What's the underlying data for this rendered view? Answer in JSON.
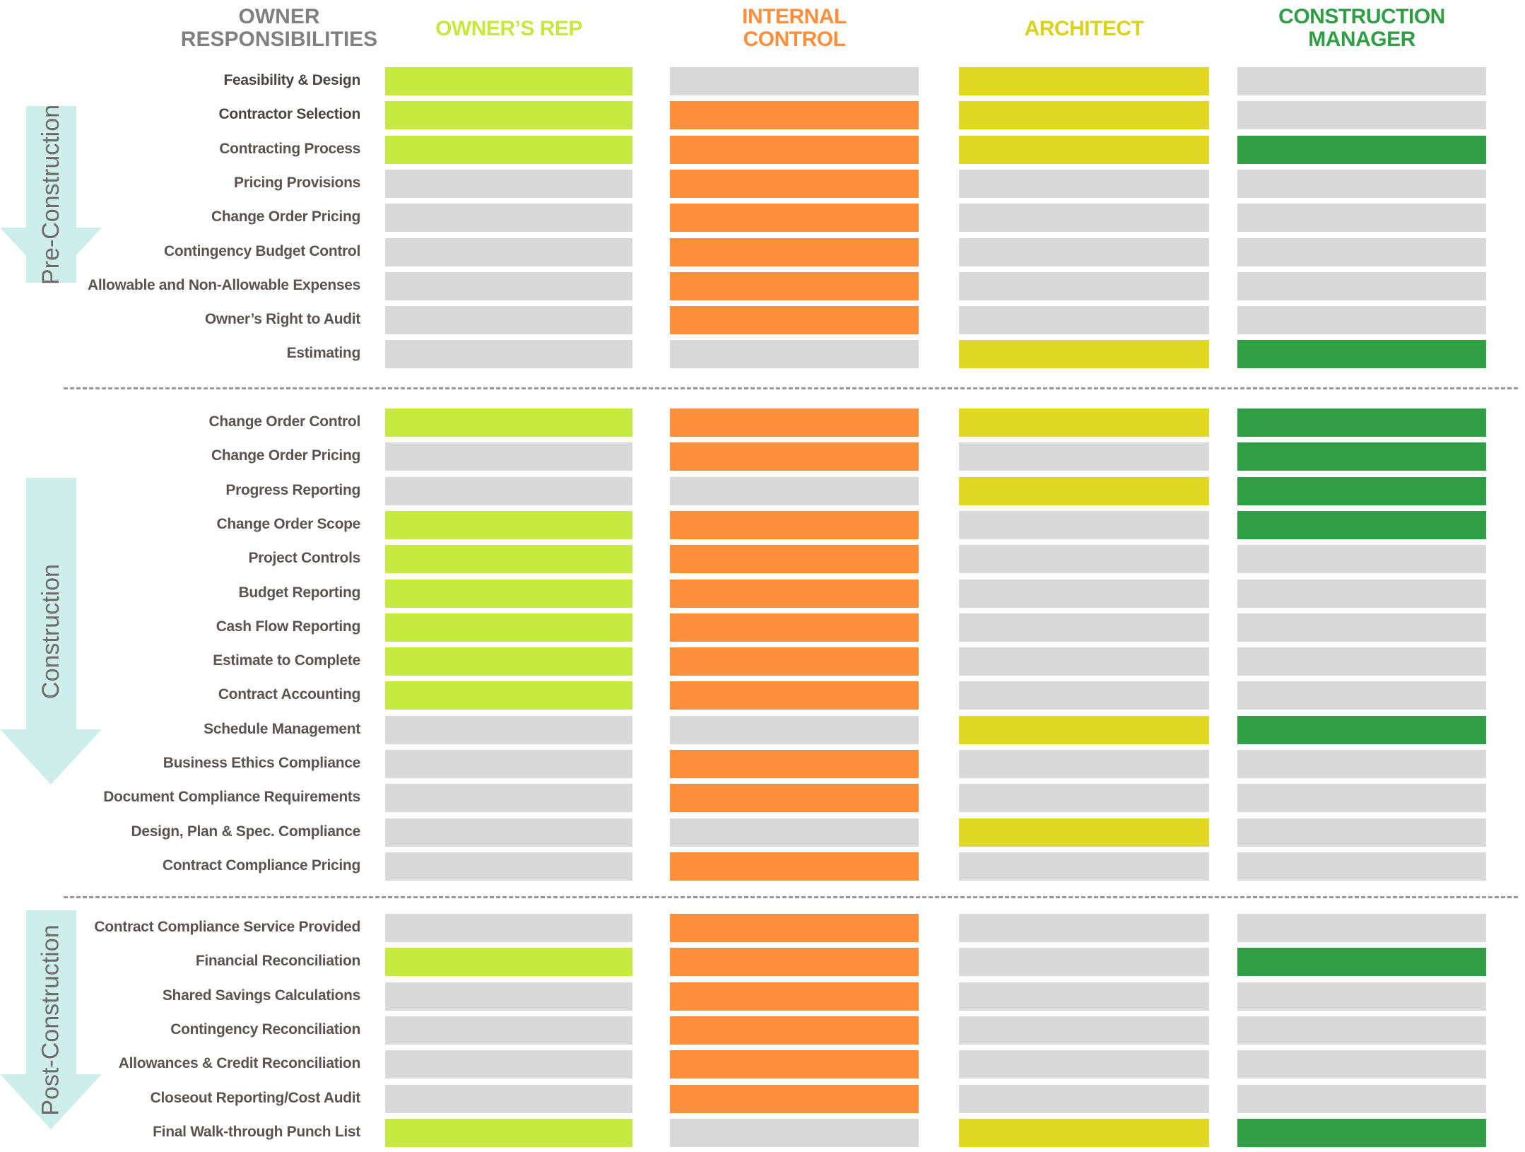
{
  "columns": [
    {
      "key": "owner_resp",
      "label": "OWNER\nRESPONSIBILITIES",
      "color": "#808080"
    },
    {
      "key": "owners_rep",
      "label": "OWNER’S REP",
      "color": "#c6e83f"
    },
    {
      "key": "internal_control",
      "label": "INTERNAL\nCONTROL",
      "color": "#fb8f3b"
    },
    {
      "key": "architect",
      "label": "ARCHITECT",
      "color": "#d9d21f"
    },
    {
      "key": "construction_manager",
      "label": "CONSTRUCTION\nMANAGER",
      "color": "#2f9e45"
    }
  ],
  "legend_colors": {
    "owners_rep": "#c6e83f",
    "internal_control": "#fb8f3b",
    "architect": "#dfd923",
    "construction_manager": "#2f9e45",
    "inactive": "#d9d9d9",
    "arrow": "#cdeeea",
    "label_text": "#5b5350",
    "divider": "#9a9a9a"
  },
  "phases": [
    {
      "key": "pre_construction",
      "label": "Pre-Construction",
      "rows": [
        {
          "label": "Feasibility & Design",
          "emphasis": true,
          "cells": [
            1,
            0,
            1,
            0
          ]
        },
        {
          "label": "Contractor Selection",
          "emphasis": true,
          "cells": [
            1,
            1,
            1,
            0
          ]
        },
        {
          "label": "Contracting Process",
          "emphasis": false,
          "cells": [
            1,
            1,
            1,
            1
          ]
        },
        {
          "label": "Pricing Provisions",
          "emphasis": false,
          "cells": [
            0,
            1,
            0,
            0
          ]
        },
        {
          "label": "Change Order Pricing",
          "emphasis": false,
          "cells": [
            0,
            1,
            0,
            0
          ]
        },
        {
          "label": "Contingency Budget Control",
          "emphasis": false,
          "cells": [
            0,
            1,
            0,
            0
          ]
        },
        {
          "label": "Allowable and Non-Allowable Expenses",
          "emphasis": false,
          "cells": [
            0,
            1,
            0,
            0
          ]
        },
        {
          "label": "Owner’s Right to Audit",
          "emphasis": false,
          "cells": [
            0,
            1,
            0,
            0
          ]
        },
        {
          "label": "Estimating",
          "emphasis": false,
          "cells": [
            0,
            0,
            1,
            1
          ]
        }
      ]
    },
    {
      "key": "construction",
      "label": "Construction",
      "rows": [
        {
          "label": "Change Order Control",
          "emphasis": false,
          "cells": [
            1,
            1,
            1,
            1
          ]
        },
        {
          "label": "Change Order Pricing",
          "emphasis": false,
          "cells": [
            0,
            1,
            0,
            1
          ]
        },
        {
          "label": "Progress Reporting",
          "emphasis": false,
          "cells": [
            0,
            0,
            1,
            1
          ]
        },
        {
          "label": "Change Order Scope",
          "emphasis": false,
          "cells": [
            1,
            1,
            0,
            1
          ]
        },
        {
          "label": "Project Controls",
          "emphasis": false,
          "cells": [
            1,
            1,
            0,
            0
          ]
        },
        {
          "label": "Budget Reporting",
          "emphasis": false,
          "cells": [
            1,
            1,
            0,
            0
          ]
        },
        {
          "label": "Cash Flow Reporting",
          "emphasis": false,
          "cells": [
            1,
            1,
            0,
            0
          ]
        },
        {
          "label": "Estimate to Complete",
          "emphasis": false,
          "cells": [
            1,
            1,
            0,
            0
          ]
        },
        {
          "label": "Contract Accounting",
          "emphasis": false,
          "cells": [
            1,
            1,
            0,
            0
          ]
        },
        {
          "label": "Schedule Management",
          "emphasis": false,
          "cells": [
            0,
            0,
            1,
            1
          ]
        },
        {
          "label": "Business Ethics Compliance",
          "emphasis": false,
          "cells": [
            0,
            1,
            0,
            0
          ]
        },
        {
          "label": "Document Compliance Requirements",
          "emphasis": false,
          "cells": [
            0,
            1,
            0,
            0
          ]
        },
        {
          "label": "Design, Plan & Spec. Compliance",
          "emphasis": false,
          "cells": [
            0,
            0,
            1,
            0
          ]
        },
        {
          "label": "Contract Compliance Pricing",
          "emphasis": false,
          "cells": [
            0,
            1,
            0,
            0
          ]
        }
      ]
    },
    {
      "key": "post_construction",
      "label": "Post-Construction",
      "rows": [
        {
          "label": "Contract Compliance Service Provided",
          "emphasis": false,
          "cells": [
            0,
            1,
            0,
            0
          ]
        },
        {
          "label": "Financial Reconciliation",
          "emphasis": false,
          "cells": [
            1,
            1,
            0,
            1
          ]
        },
        {
          "label": "Shared Savings Calculations",
          "emphasis": false,
          "cells": [
            0,
            1,
            0,
            0
          ]
        },
        {
          "label": "Contingency Reconciliation",
          "emphasis": false,
          "cells": [
            0,
            1,
            0,
            0
          ]
        },
        {
          "label": "Allowances & Credit Reconciliation",
          "emphasis": false,
          "cells": [
            0,
            1,
            0,
            0
          ]
        },
        {
          "label": "Closeout Reporting/Cost Audit",
          "emphasis": false,
          "cells": [
            0,
            1,
            0,
            0
          ]
        },
        {
          "label": "Final Walk-through Punch List",
          "emphasis": false,
          "cells": [
            1,
            0,
            1,
            1
          ]
        }
      ]
    }
  ]
}
